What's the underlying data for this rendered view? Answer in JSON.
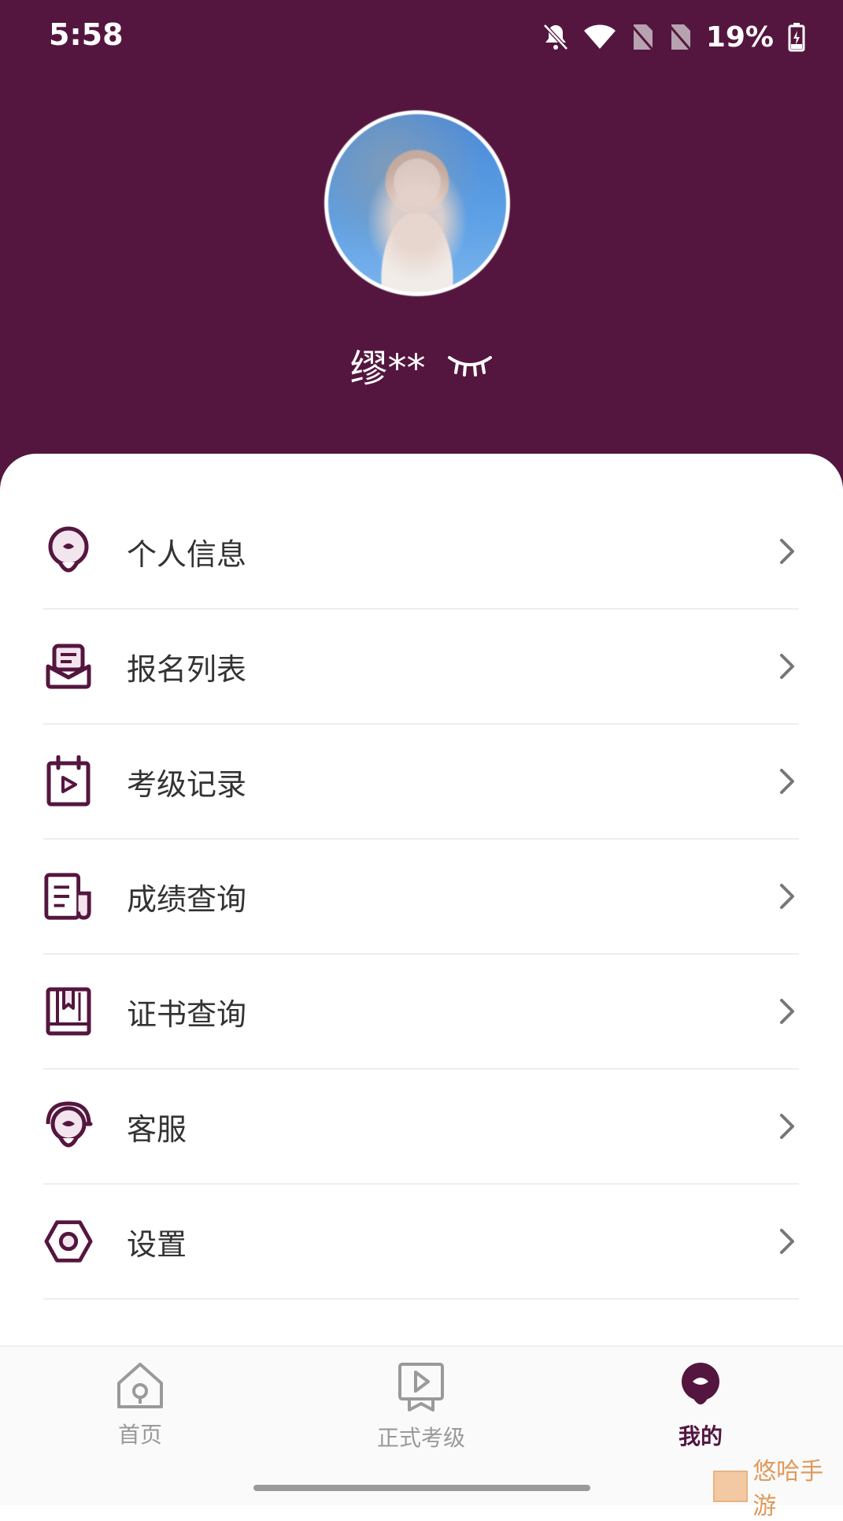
{
  "status_bar": {
    "time": "5:58",
    "battery": "19%"
  },
  "profile": {
    "name": "缪**"
  },
  "menu": [
    {
      "label": "个人信息",
      "icon": "person-icon"
    },
    {
      "label": "报名列表",
      "icon": "registration-list-icon"
    },
    {
      "label": "考级记录",
      "icon": "exam-record-icon"
    },
    {
      "label": "成绩查询",
      "icon": "score-query-icon"
    },
    {
      "label": "证书查询",
      "icon": "certificate-query-icon"
    },
    {
      "label": "客服",
      "icon": "customer-service-icon"
    },
    {
      "label": "设置",
      "icon": "settings-icon"
    }
  ],
  "tabs": [
    {
      "label": "首页",
      "active": false
    },
    {
      "label": "正式考级",
      "active": false
    },
    {
      "label": "我的",
      "active": true
    }
  ],
  "watermark": "悠哈手游",
  "colors": {
    "brand": "#54163f",
    "text": "#333333",
    "tab_inactive": "#999999"
  }
}
